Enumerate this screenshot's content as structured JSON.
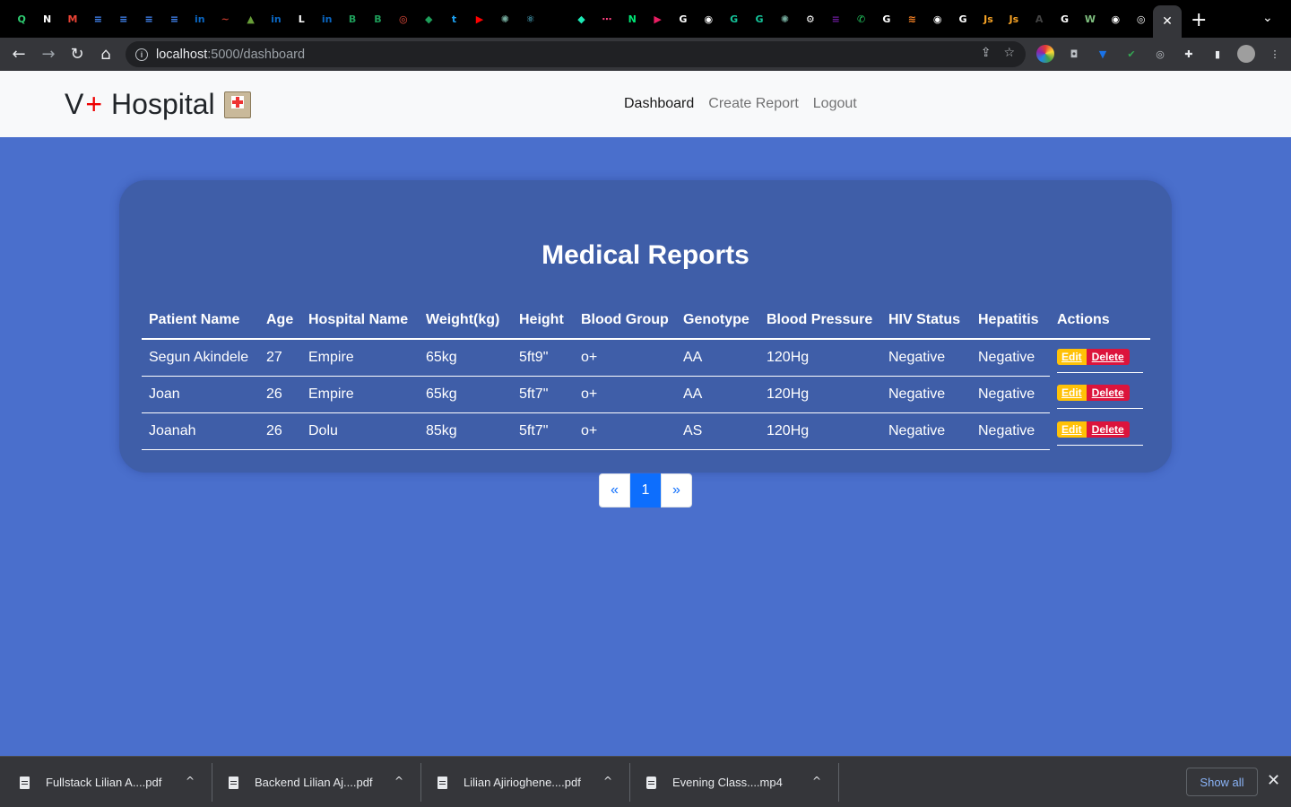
{
  "browser": {
    "url_host": "localhost",
    "url_path": ":5000/dashboard",
    "tab_favicons": [
      {
        "name": "quora-favicon",
        "color": "#2ecc71",
        "glyph": "Q"
      },
      {
        "name": "notion-favicon",
        "color": "#ffffff",
        "glyph": "N"
      },
      {
        "name": "gmail-favicon",
        "color": "#ea4335",
        "glyph": "M"
      },
      {
        "name": "docs-favicon",
        "color": "#4285f4",
        "glyph": "≡"
      },
      {
        "name": "docs-favicon",
        "color": "#4285f4",
        "glyph": "≡"
      },
      {
        "name": "docs-favicon",
        "color": "#4285f4",
        "glyph": "≡"
      },
      {
        "name": "docs-favicon",
        "color": "#4285f4",
        "glyph": "≡"
      },
      {
        "name": "linkedin-favicon",
        "color": "#0a66c2",
        "glyph": "in"
      },
      {
        "name": "app-favicon",
        "color": "#c0392b",
        "glyph": "~"
      },
      {
        "name": "app-favicon",
        "color": "#689f38",
        "glyph": "▲"
      },
      {
        "name": "linkedin-favicon",
        "color": "#0a66c2",
        "glyph": "in"
      },
      {
        "name": "app-favicon",
        "color": "#ffffff",
        "glyph": "L"
      },
      {
        "name": "linkedin-favicon",
        "color": "#0a66c2",
        "glyph": "in"
      },
      {
        "name": "app-favicon",
        "color": "#1e9e5a",
        "glyph": "B"
      },
      {
        "name": "app-favicon",
        "color": "#1e9e5a",
        "glyph": "B"
      },
      {
        "name": "app-favicon",
        "color": "#e74c3c",
        "glyph": "◎"
      },
      {
        "name": "app-favicon",
        "color": "#1e9e5a",
        "glyph": "◆"
      },
      {
        "name": "twitter-favicon",
        "color": "#1da1f2",
        "glyph": "t"
      },
      {
        "name": "youtube-favicon",
        "color": "#ff0000",
        "glyph": "▶"
      },
      {
        "name": "chatgpt-favicon",
        "color": "#74aa9c",
        "glyph": "✺"
      },
      {
        "name": "react-favicon",
        "color": "#61dafb",
        "glyph": "⚛"
      },
      {
        "name": "blank-favicon",
        "color": "#000000",
        "glyph": ""
      },
      {
        "name": "app-favicon",
        "color": "#1de9b6",
        "glyph": "◆"
      },
      {
        "name": "app-favicon",
        "color": "#ff4081",
        "glyph": "⋯"
      },
      {
        "name": "app-favicon",
        "color": "#00e676",
        "glyph": "N"
      },
      {
        "name": "app-favicon",
        "color": "#e91e63",
        "glyph": "▶"
      },
      {
        "name": "google-favicon",
        "color": "#ffffff",
        "glyph": "G"
      },
      {
        "name": "github-favicon",
        "color": "#ffffff",
        "glyph": "◉"
      },
      {
        "name": "grammarly-favicon",
        "color": "#15c39a",
        "glyph": "G"
      },
      {
        "name": "grammarly-favicon",
        "color": "#15c39a",
        "glyph": "G"
      },
      {
        "name": "chatgpt-favicon",
        "color": "#74aa9c",
        "glyph": "✺"
      },
      {
        "name": "settings-favicon",
        "color": "#ffffff",
        "glyph": "⚙"
      },
      {
        "name": "app-favicon",
        "color": "#6a1b9a",
        "glyph": "≡"
      },
      {
        "name": "whatsapp-favicon",
        "color": "#25d366",
        "glyph": "✆"
      },
      {
        "name": "google-favicon",
        "color": "#ffffff",
        "glyph": "G"
      },
      {
        "name": "stackoverflow-favicon",
        "color": "#f48024",
        "glyph": "≋"
      },
      {
        "name": "github-favicon",
        "color": "#ffffff",
        "glyph": "◉"
      },
      {
        "name": "google-favicon",
        "color": "#ffffff",
        "glyph": "G"
      },
      {
        "name": "js-favicon",
        "color": "#f7a325",
        "glyph": "Js"
      },
      {
        "name": "js-favicon",
        "color": "#f7a325",
        "glyph": "Js"
      },
      {
        "name": "app-favicon",
        "color": "#444444",
        "glyph": "A"
      },
      {
        "name": "google-favicon",
        "color": "#ffffff",
        "glyph": "G"
      },
      {
        "name": "app-favicon",
        "color": "#7fbf7f",
        "glyph": "W"
      },
      {
        "name": "github-favicon",
        "color": "#ffffff",
        "glyph": "◉"
      },
      {
        "name": "chrome-favicon",
        "color": "#ffffff",
        "glyph": "◎"
      }
    ]
  },
  "app": {
    "brand_prefix": "V",
    "brand_plus": "+",
    "brand_name": "Hospital",
    "nav": [
      "Dashboard",
      "Create Report",
      "Logout"
    ]
  },
  "main": {
    "title": "Medical Reports",
    "columns": [
      "Patient Name",
      "Age",
      "Hospital Name",
      "Weight(kg)",
      "Height",
      "Blood Group",
      "Genotype",
      "Blood Pressure",
      "HIV Status",
      "Hepatitis",
      "Actions"
    ],
    "rows": [
      [
        "Segun Akindele",
        "27",
        "Empire",
        "65kg",
        "5ft9\"",
        "o+",
        "AA",
        "120Hg",
        "Negative",
        "Negative"
      ],
      [
        "Joan",
        "26",
        "Empire",
        "65kg",
        "5ft7\"",
        "o+",
        "AA",
        "120Hg",
        "Negative",
        "Negative"
      ],
      [
        "Joanah",
        "26",
        "Dolu",
        "85kg",
        "5ft7\"",
        "o+",
        "AS",
        "120Hg",
        "Negative",
        "Negative"
      ]
    ],
    "edit_label": "Edit",
    "delete_label": "Delete",
    "pagination": {
      "prev": "«",
      "current": "1",
      "next": "»"
    }
  },
  "downloads": {
    "items": [
      "Fullstack Lilian A....pdf",
      "Backend Lilian Aj....pdf",
      "Lilian Ajirioghene....pdf",
      "Evening Class....mp4"
    ],
    "show_all": "Show all"
  }
}
